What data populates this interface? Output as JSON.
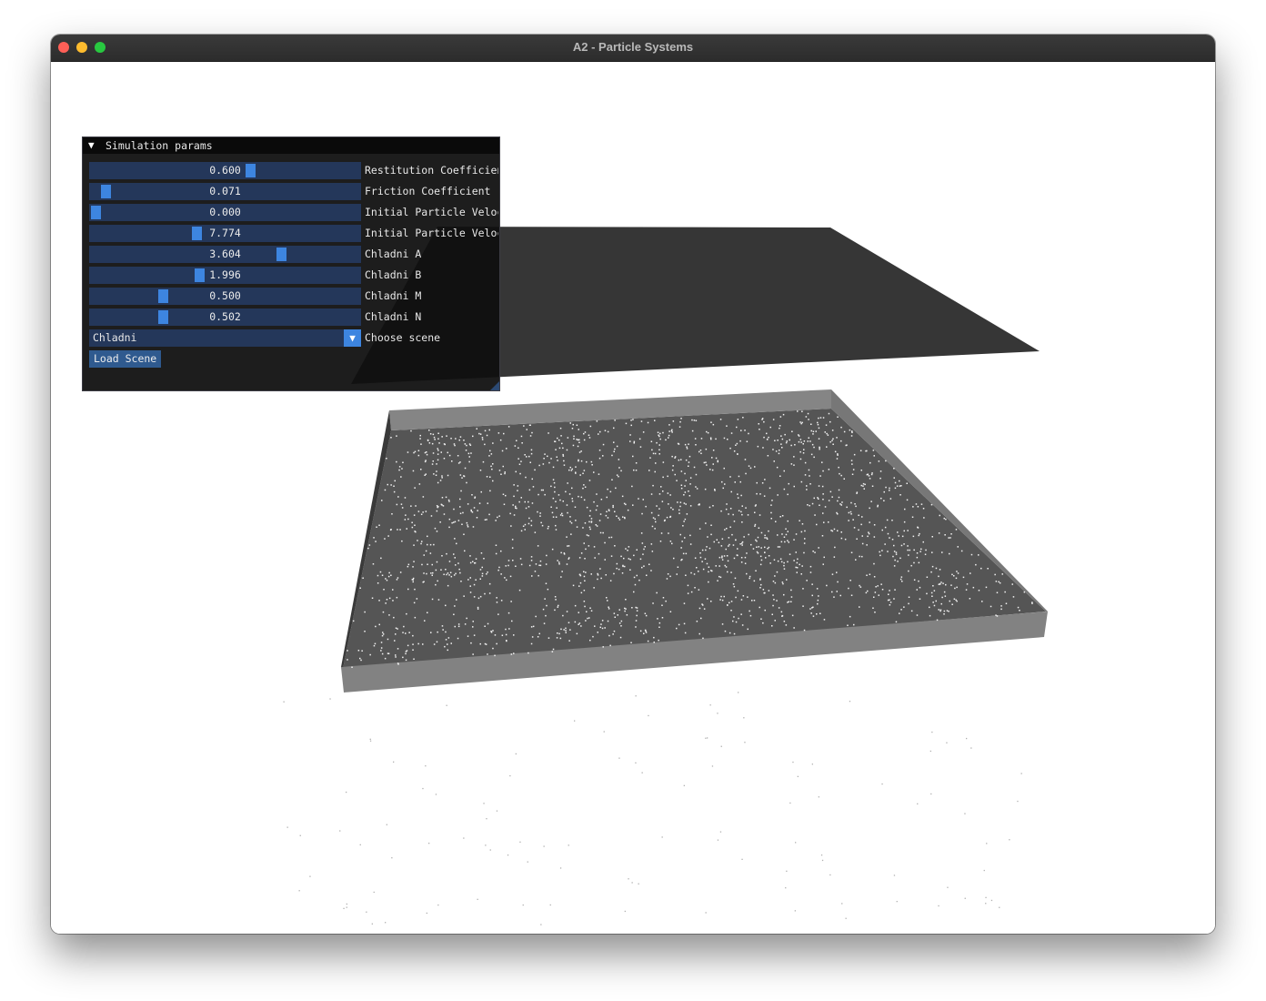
{
  "window": {
    "title": "A2 - Particle Systems"
  },
  "panel": {
    "title": "Simulation params",
    "sliders": [
      {
        "value": "0.600",
        "label": "Restitution Coefficient",
        "fraction": 0.6
      },
      {
        "value": "0.071",
        "label": "Friction Coefficient",
        "fraction": 0.04
      },
      {
        "value": "0.000",
        "label": "Initial Particle Velocity",
        "fraction": 0.0
      },
      {
        "value": "7.774",
        "label": "Initial Particle Velocity",
        "fraction": 0.39
      },
      {
        "value": "3.604",
        "label": "Chladni A",
        "fraction": 0.72
      },
      {
        "value": "1.996",
        "label": "Chladni B",
        "fraction": 0.4
      },
      {
        "value": "0.500",
        "label": "Chladni M",
        "fraction": 0.26
      },
      {
        "value": "0.502",
        "label": "Chladni N",
        "fraction": 0.26
      }
    ],
    "combo": {
      "value": "Chladni",
      "label": "Choose scene"
    },
    "button_label": "Load Scene"
  },
  "colors": {
    "accent": "#3d85e0",
    "frame_bg": "#24375a",
    "panel_bg": "#0f0f0f",
    "top_plate": "#363636",
    "box_floor": "#555555",
    "box_wall": "#838383"
  }
}
